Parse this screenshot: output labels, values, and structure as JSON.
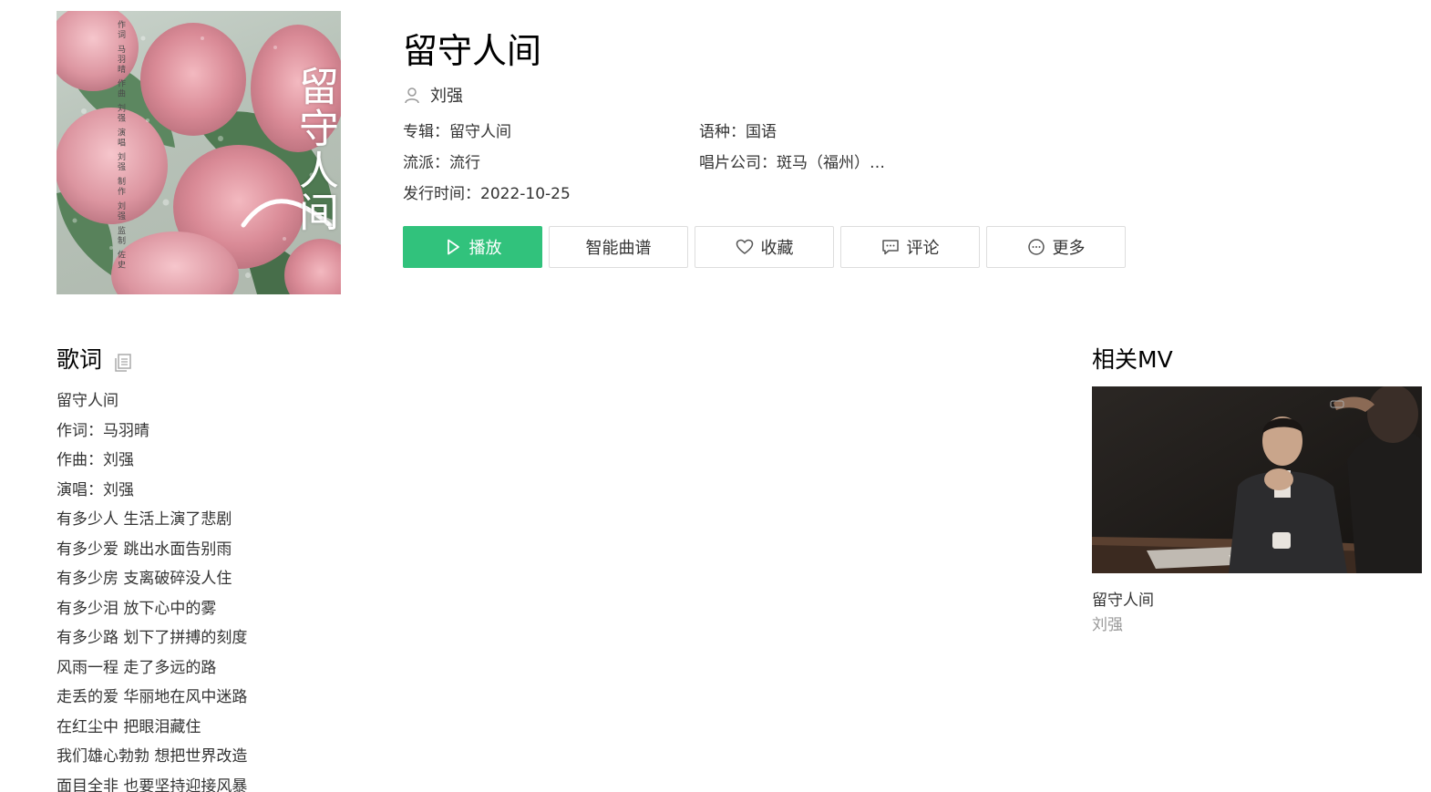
{
  "song": {
    "title": "留守人间",
    "artist": "刘强",
    "album_label": "专辑：",
    "album": "留守人间",
    "language_label": "语种：",
    "language": "国语",
    "genre_label": "流派：",
    "genre": "流行",
    "label_label": "唱片公司：",
    "label": "斑马（福州）…",
    "release_label": "发行时间：",
    "release_date": "2022-10-25"
  },
  "cover": {
    "title_art": "留守人间",
    "credits": "作词 马羽晴 作曲 刘强 演唱 刘强 制作 刘强 监制 佐史"
  },
  "actions": {
    "play": "播放",
    "sheet": "智能曲谱",
    "favorite": "收藏",
    "comment": "评论",
    "more": "更多"
  },
  "lyrics": {
    "title": "歌词",
    "lines": [
      "留守人间",
      "作词：马羽晴",
      "作曲：刘强",
      "演唱：刘强",
      "有多少人 生活上演了悲剧",
      "有多少爱 跳出水面告别雨",
      "有多少房 支离破碎没人住",
      "有多少泪 放下心中的雾",
      "有多少路 划下了拼搏的刻度",
      "风雨一程 走了多远的路",
      "走丢的爱 华丽地在风中迷路",
      "在红尘中 把眼泪藏住",
      "我们雄心勃勃 想把世界改造",
      "面目全非 也要坚持迎接风暴"
    ]
  },
  "related_mv": {
    "title": "相关MV",
    "items": [
      {
        "title": "留守人间",
        "artist": "刘强"
      }
    ]
  },
  "icons": {
    "artist": "user-icon",
    "play": "play-icon",
    "favorite": "heart-icon",
    "comment": "comment-icon",
    "more": "more-icon",
    "copy": "copy-icon"
  },
  "colors": {
    "accent": "#31c27c",
    "text": "#333333",
    "muted": "#999999",
    "border": "#dddddd"
  }
}
